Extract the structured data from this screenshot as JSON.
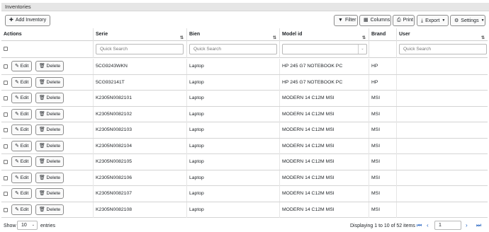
{
  "panel": {
    "title": "Inventories"
  },
  "toolbar": {
    "add_label": "Add Inventory",
    "filter_label": "Filter",
    "columns_label": "Columns",
    "print_label": "Print",
    "export_label": "Export",
    "settings_label": "Settings"
  },
  "table": {
    "headers": {
      "actions": "Actions",
      "serie": "Serie",
      "bien": "Bien",
      "model": "Model id",
      "brand": "Brand",
      "user": "User"
    },
    "quick_search_placeholder": "Quick Search",
    "edit_label": "Edit",
    "delete_label": "Delete",
    "rows": [
      {
        "serie": "5CG9243WKN",
        "bien": "Laptop",
        "model": "HP 245 G7 NOTEBOOK PC",
        "brand": "HP",
        "user": ""
      },
      {
        "serie": "5CG932141T",
        "bien": "Laptop",
        "model": "HP 245 G7 NOTEBOOK PC",
        "brand": "HP",
        "user": ""
      },
      {
        "serie": "K2305N0082101",
        "bien": "Laptop",
        "model": "MODERN 14 C12M MSI",
        "brand": "MSI",
        "user": ""
      },
      {
        "serie": "K2305N0082102",
        "bien": "Laptop",
        "model": "MODERN 14 C12M MSI",
        "brand": "MSI",
        "user": ""
      },
      {
        "serie": "K2305N0082103",
        "bien": "Laptop",
        "model": "MODERN 14 C12M MSI",
        "brand": "MSI",
        "user": ""
      },
      {
        "serie": "K2305N0082104",
        "bien": "Laptop",
        "model": "MODERN 14 C12M MSI",
        "brand": "MSI",
        "user": ""
      },
      {
        "serie": "K2305N0082105",
        "bien": "Laptop",
        "model": "MODERN 14 C12M MSI",
        "brand": "MSI",
        "user": ""
      },
      {
        "serie": "K2305N0082106",
        "bien": "Laptop",
        "model": "MODERN 14 C12M MSI",
        "brand": "MSI",
        "user": ""
      },
      {
        "serie": "K2305N0082107",
        "bien": "Laptop",
        "model": "MODERN 14 C12M MSI",
        "brand": "MSI",
        "user": ""
      },
      {
        "serie": "K2305N0082108",
        "bien": "Laptop",
        "model": "MODERN 14 C12M MSI",
        "brand": "MSI",
        "user": ""
      }
    ]
  },
  "footer": {
    "show_label": "Show",
    "page_size": "10",
    "entries_label": "entries",
    "displaying": "Displaying 1 to 10 of 52 items",
    "current_page": "1"
  },
  "colors": {
    "link": "#1f5fbf",
    "border": "#8c8c8c"
  }
}
